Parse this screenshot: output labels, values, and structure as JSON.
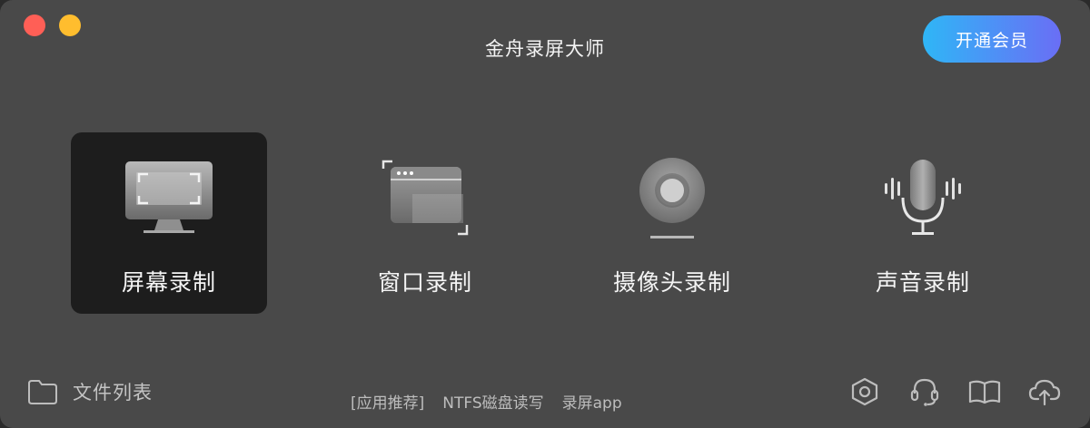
{
  "window": {
    "title": "金舟录屏大师",
    "colors": {
      "close": "#ff5f56",
      "minimize": "#ffbd2e"
    }
  },
  "header": {
    "vip_button": "开通会员",
    "vip_colors": [
      "#2fb6f6",
      "#6a6ef5"
    ]
  },
  "modes": [
    {
      "id": "screen",
      "label": "屏幕录制",
      "icon": "monitor-icon",
      "active": true
    },
    {
      "id": "window",
      "label": "窗口录制",
      "icon": "window-icon",
      "active": false
    },
    {
      "id": "camera",
      "label": "摄像头录制",
      "icon": "webcam-icon",
      "active": false
    },
    {
      "id": "audio",
      "label": "声音录制",
      "icon": "microphone-icon",
      "active": false
    }
  ],
  "footer": {
    "file_list": "文件列表",
    "recommend_tag": "[应用推荐]",
    "recommend_links": [
      "NTFS磁盘读写",
      "录屏app"
    ],
    "tools": [
      "settings-icon",
      "customer-service-icon",
      "help-book-icon",
      "upload-cloud-icon"
    ]
  }
}
